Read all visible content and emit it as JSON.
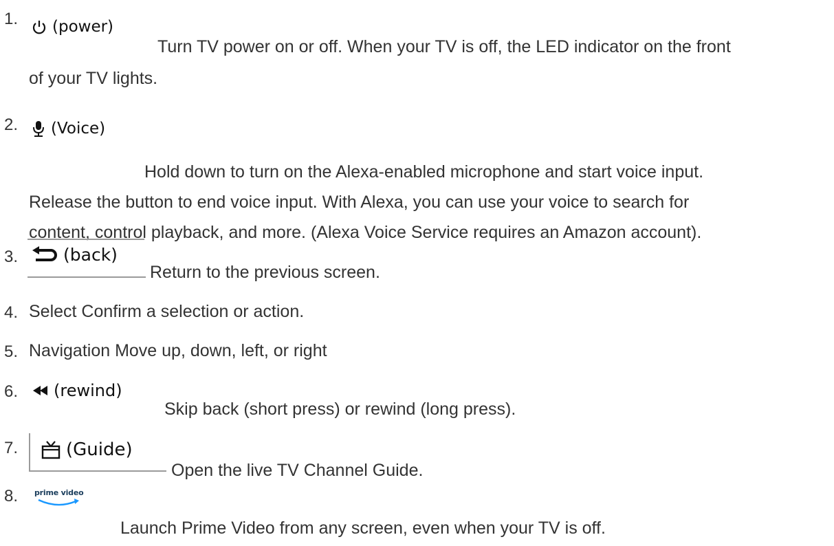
{
  "items": [
    {
      "number": "1.",
      "button": "(power)",
      "icon": "power-icon",
      "line1": "Turn TV power on or off. When your TV is off, the LED indicator on the front",
      "line2": "of your TV lights."
    },
    {
      "number": "2.",
      "button": "(Voice)",
      "icon": "microphone-icon",
      "line1": "Hold down to turn on the Alexa-enabled microphone and start voice input.",
      "line2": "Release the button to end voice input. With Alexa, you can use your voice to search for",
      "line3": "content, control playback, and more. (Alexa Voice Service requires an Amazon account)."
    },
    {
      "number": "3.",
      "button": "(back)",
      "icon": "back-arrow-icon",
      "line1": "Return to the previous screen."
    },
    {
      "number": "4.",
      "line1": "Select Confirm a selection or action."
    },
    {
      "number": "5.",
      "line1": "Navigation Move up, down, left, or right"
    },
    {
      "number": "6.",
      "button": "(rewind)",
      "icon": "rewind-icon",
      "line1": "Skip back (short press) or rewind (long press)."
    },
    {
      "number": "7.",
      "button": "(Guide)",
      "icon": "tv-guide-icon",
      "line1": "Open the live TV Channel Guide."
    },
    {
      "number": "8.",
      "button": "prime video",
      "icon": "prime-video-logo",
      "line1": "Launch Prime Video from any screen, even when your TV is off."
    }
  ]
}
